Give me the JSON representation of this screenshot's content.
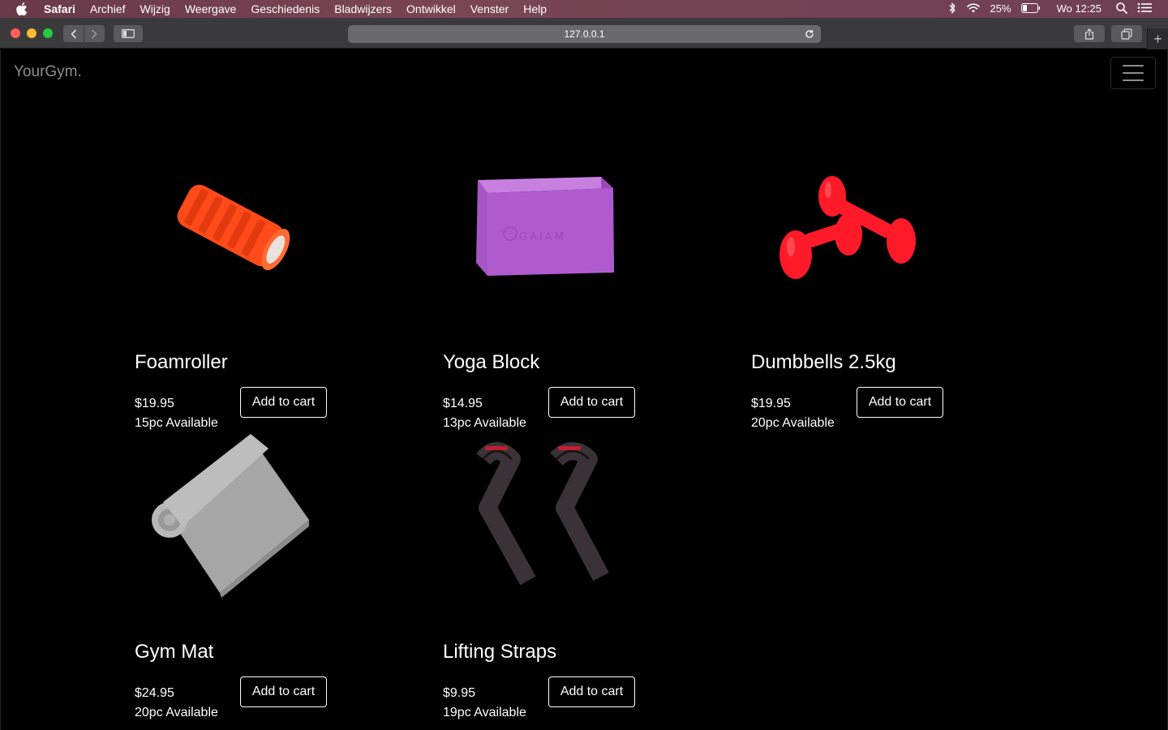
{
  "menubar": {
    "app": "Safari",
    "items": [
      "Archief",
      "Wijzig",
      "Weergave",
      "Geschiedenis",
      "Bladwijzers",
      "Ontwikkel",
      "Venster",
      "Help"
    ],
    "battery": "25%",
    "clock": "Wo 12:25"
  },
  "browser": {
    "url": "127.0.0.1",
    "new_tab": "+"
  },
  "site": {
    "brand": "YourGym."
  },
  "products": [
    {
      "name": "Foamroller",
      "price": "$19.95",
      "stock": "15pc Available",
      "button": "Add to cart",
      "image": "foam-roller-image",
      "color": "#ff4a1a"
    },
    {
      "name": "Yoga Block",
      "price": "$14.95",
      "stock": "13pc Available",
      "button": "Add to cart",
      "image": "yoga-block-image",
      "color": "#b05ad0"
    },
    {
      "name": "Dumbbells 2.5kg",
      "price": "$19.95",
      "stock": "20pc Available",
      "button": "Add to cart",
      "image": "dumbbells-image",
      "color": "#ff1a2a"
    },
    {
      "name": "Gym Mat",
      "price": "$24.95",
      "stock": "20pc Available",
      "button": "Add to cart",
      "image": "gym-mat-image",
      "color": "#a6a6a6"
    },
    {
      "name": "Lifting Straps",
      "price": "$9.95",
      "stock": "19pc Available",
      "button": "Add to cart",
      "image": "lifting-straps-image",
      "color": "#3a3238"
    }
  ]
}
